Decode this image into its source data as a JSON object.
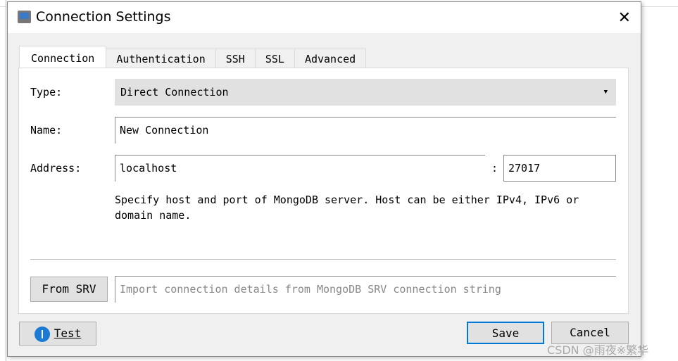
{
  "dialog": {
    "title": "Connection Settings",
    "icon": "computer-icon",
    "close_icon": "close-icon"
  },
  "tabs": [
    {
      "label": "Connection",
      "active": true
    },
    {
      "label": "Authentication"
    },
    {
      "label": "SSH"
    },
    {
      "label": "SSL"
    },
    {
      "label": "Advanced"
    }
  ],
  "form": {
    "type_label": "Type:",
    "type_value": "Direct Connection",
    "name_label": "Name:",
    "name_value": "New Connection",
    "address_label": "Address:",
    "host_value": "localhost",
    "colon": ":",
    "port_value": "27017",
    "help": "Specify host and port of MongoDB server. Host can be either IPv4, IPv6 or domain name.",
    "from_srv_label": "From SRV",
    "srv_placeholder": "Import connection details from MongoDB SRV connection string"
  },
  "buttons": {
    "test": "Test",
    "save": "Save",
    "cancel": "Cancel"
  },
  "watermark": "CSDN @雨夜※繁华",
  "colors": {
    "accent": "#0078d7",
    "info": "#1a7ad4"
  }
}
